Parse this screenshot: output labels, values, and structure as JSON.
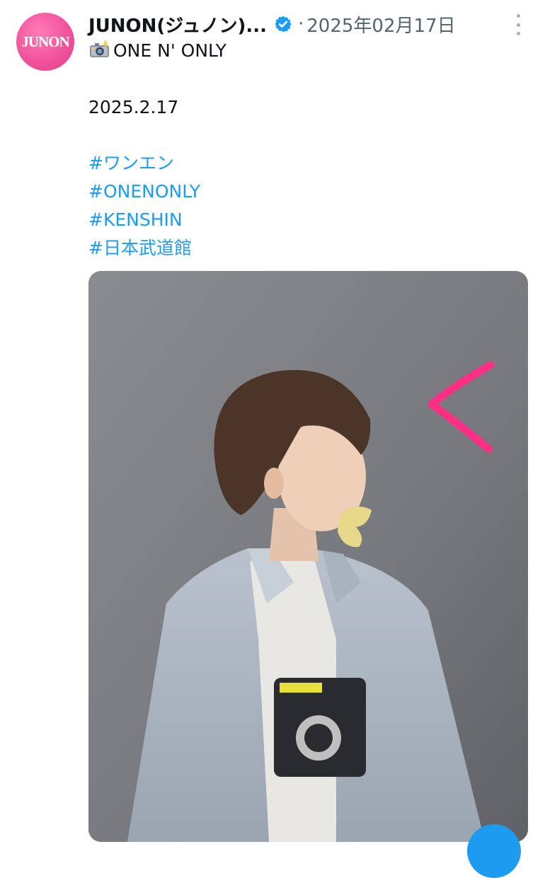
{
  "tweet": {
    "author": {
      "name": "JUNON(ジュノン)...",
      "avatar_text": "JUNON",
      "avatar_color": "#f0509a",
      "verified_icon": "verified-badge-icon"
    },
    "separator": "·",
    "date": "2025年02月17日",
    "more_icon": "more-options-icon",
    "text_line1": "ONE N' ONLY",
    "text_line1_icon": "camera-with-flash-icon",
    "date_line": "2025.2.17",
    "hashtags": [
      "#ワンエン",
      "#ONENONLY",
      "#KENSHIN",
      "#日本武道館"
    ],
    "media_description": "photo",
    "colors": {
      "link": "#1d9bf0",
      "secondary_text": "#536471",
      "annotation_arrow": "#ff2f86"
    }
  }
}
